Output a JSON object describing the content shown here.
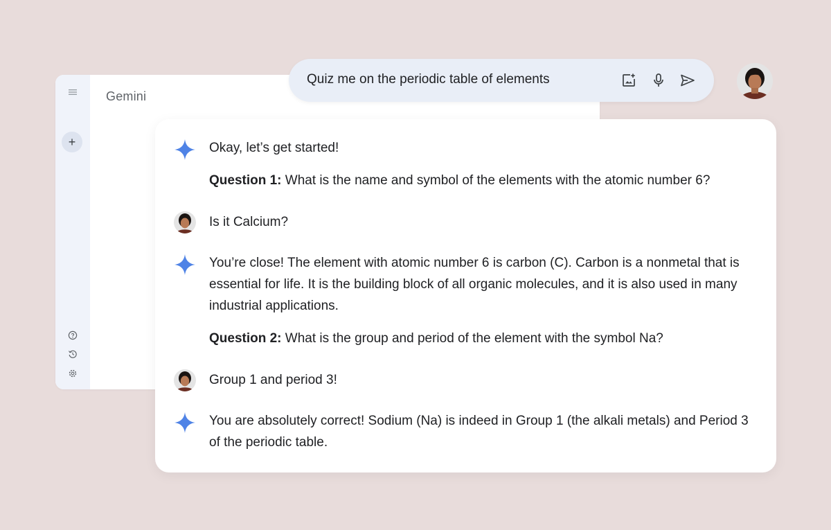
{
  "app": {
    "title": "Gemini",
    "icons": [
      "menu-icon",
      "plus-icon",
      "help-icon",
      "history-icon",
      "settings-icon"
    ]
  },
  "prompt": {
    "text": "Quiz me on the periodic table of elements",
    "icons": [
      "add-image-icon",
      "mic-icon",
      "send-icon"
    ]
  },
  "chat": {
    "messages": [
      {
        "sender": "gemini",
        "text": "Okay, let’s get started!"
      },
      {
        "sender": "gemini",
        "label": "Question 1:",
        "text": " What is the name and symbol of the elements with the atomic number 6?"
      },
      {
        "sender": "user",
        "text": "Is it Calcium?"
      },
      {
        "sender": "gemini",
        "text": "You’re close! The element with atomic number 6 is carbon (C). Carbon is a nonmetal that is essential for life. It is the building block of all organic molecules, and it is also used in many industrial applications."
      },
      {
        "sender": "gemini",
        "label": "Question 2:",
        "text": " What is the group and period of the element with the symbol Na?"
      },
      {
        "sender": "user",
        "text": "Group 1 and period 3!"
      },
      {
        "sender": "gemini",
        "text": "You are absolutely correct! Sodium (Na) is indeed in Group 1 (the alkali metals) and Period 3 of the periodic table."
      }
    ]
  },
  "colors": {
    "background": "#e8dcdb",
    "side_rail": "#f0f3fa",
    "prompt_bar": "#e9eef7",
    "gemini_sparkle": "#4f83e6"
  }
}
